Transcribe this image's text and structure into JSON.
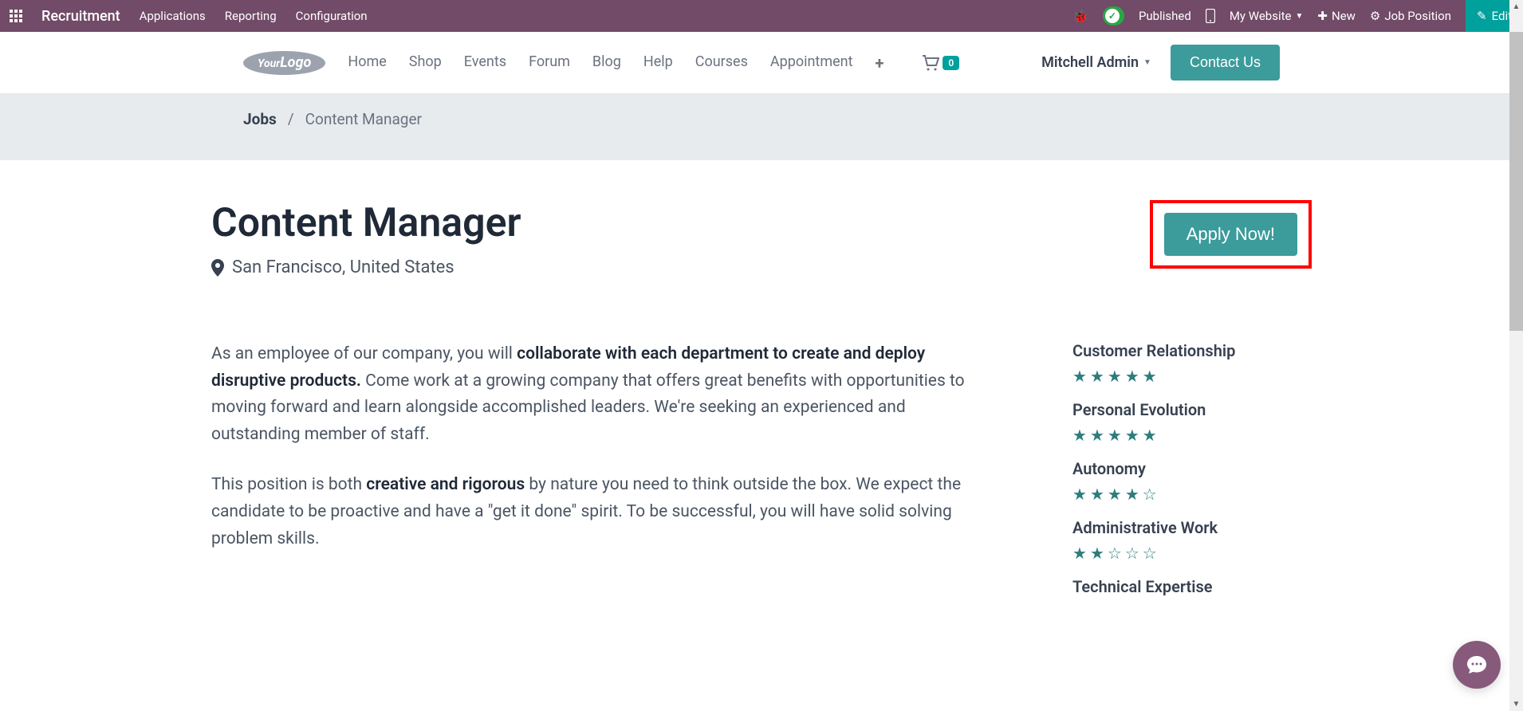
{
  "admin": {
    "title": "Recruitment",
    "links": [
      "Applications",
      "Reporting",
      "Configuration"
    ],
    "published": "Published",
    "my_website": "My Website",
    "new": "New",
    "job_position": "Job Position",
    "edit": "Edit"
  },
  "header": {
    "logo_part1": "Your",
    "logo_part2": "Logo",
    "nav": [
      "Home",
      "Shop",
      "Events",
      "Forum",
      "Blog",
      "Help",
      "Courses",
      "Appointment"
    ],
    "cart_count": "0",
    "user": "Mitchell Admin",
    "contact": "Contact Us"
  },
  "breadcrumb": {
    "root": "Jobs",
    "sep": "/",
    "current": "Content Manager"
  },
  "job": {
    "title": "Content Manager",
    "location": "San Francisco, United States",
    "apply": "Apply Now!",
    "p1_before": "As an employee of our company, you will ",
    "p1_bold": "collaborate with each department to create and deploy disruptive products.",
    "p1_after": " Come work at a growing company that offers great benefits with opportunities to moving forward and learn alongside accomplished leaders. We're seeking an experienced and outstanding member of staff.",
    "p2_before": "This position is both ",
    "p2_bold": "creative and rigorous",
    "p2_after": " by nature you need to think outside the box. We expect the candidate to be proactive and have a \"get it done\" spirit. To be successful, you will have solid solving problem skills."
  },
  "ratings": [
    {
      "label": "Customer Relationship",
      "stars": 5
    },
    {
      "label": "Personal Evolution",
      "stars": 5
    },
    {
      "label": "Autonomy",
      "stars": 4
    },
    {
      "label": "Administrative Work",
      "stars": 2
    },
    {
      "label": "Technical Expertise",
      "stars": 0
    }
  ]
}
